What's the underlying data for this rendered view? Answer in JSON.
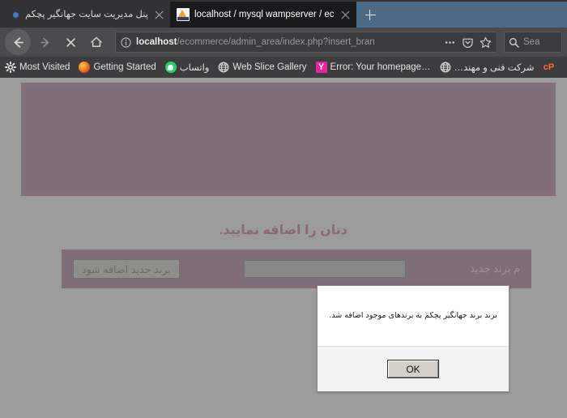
{
  "browser": {
    "tabs": [
      {
        "title": "پنل مدیریت سایت جهانگیر پچکم",
        "active": false,
        "favicon": "loading-dot-icon",
        "rtl": true
      },
      {
        "title": "localhost / mysql wampserver / ec",
        "active": true,
        "favicon": "phpmyadmin-icon",
        "rtl": false
      }
    ],
    "new_tab_label": "+",
    "toolbar": {
      "back": "back-arrow-icon",
      "forward": "forward-arrow-icon",
      "stop": "stop-x-icon",
      "home": "home-icon",
      "page_actions": "ellipsis-icon",
      "reader_pocket": "pocket-icon",
      "bookmark_star": "star-icon"
    },
    "url": {
      "identity_icon": "info-circle-icon",
      "host": "localhost",
      "path": "/ecommerce/admin_area/index.php?insert_bran"
    },
    "search": {
      "icon": "search-icon",
      "placeholder": "Sea"
    },
    "bookmarks": [
      {
        "label": "Most Visited",
        "icon": "gear-icon",
        "rtl": false
      },
      {
        "label": "Getting Started",
        "icon": "firefox-icon",
        "rtl": false
      },
      {
        "label": "واتساب",
        "icon": "whatsapp-icon",
        "rtl": true
      },
      {
        "label": "Web Slice Gallery",
        "icon": "globe-icon",
        "rtl": false
      },
      {
        "label": "Error: Your homepage…",
        "icon": "yam-icon",
        "rtl": false
      },
      {
        "label": "شرکت فنی و مهند…",
        "icon": "globe-icon",
        "rtl": true
      },
      {
        "label": "",
        "icon": "cpanel-icon",
        "rtl": false
      }
    ]
  },
  "page": {
    "heading": "دتان را اضافه نمایید.",
    "form": {
      "label": "م برند جدید",
      "input_value": "",
      "input_placeholder": "",
      "submit_label": "برند جدید اضافه شود"
    }
  },
  "dialog": {
    "message": "برند برند جهانگیر پچکم به برندهای موجود اضافه شد.",
    "ok_label": "OK"
  },
  "colors": {
    "chrome_dark": "#323234",
    "chrome_nav": "#4a4a4c",
    "chrome_bookmarks": "#3d3d3f",
    "tab_active": "#1a1a1c",
    "newtab_blue": "#4c6a86",
    "page_purple": "#7d2a57",
    "page_purple_border": "#8e3a66",
    "heading_crimson": "#a3174a",
    "dim_overlay": "#808080",
    "cpanel_orange": "#ff6c2c",
    "whatsapp_green": "#25d366"
  }
}
